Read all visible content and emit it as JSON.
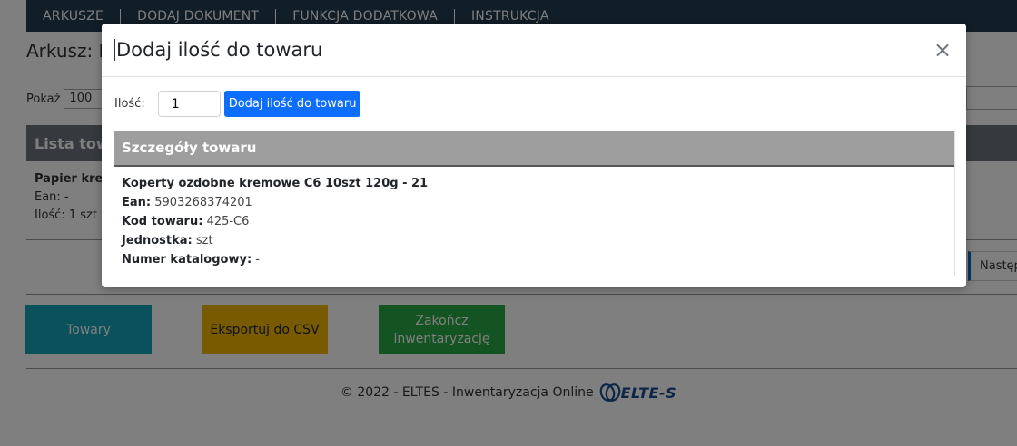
{
  "nav": {
    "items": [
      "ARKUSZE",
      "DODAJ DOKUMENT",
      "FUNKCJA DODATKOWA",
      "INSTRUKCJA"
    ]
  },
  "page": {
    "sheet_title": "Arkusz: I",
    "show_label": "Pokaż",
    "show_value": "100",
    "list_header": "Lista towa",
    "list_item": {
      "name": "Papier kre",
      "ean": "Ean: -",
      "qty": "Ilość: 1 szt"
    },
    "next_label": "Następ"
  },
  "buttons": {
    "towary": "Towary",
    "export": "Eksportuj do CSV",
    "finish": "Zakończ inwentaryzację"
  },
  "footer": {
    "text": "© 2022 - ELTES - Inwentaryzacja Online",
    "logo_text": "ELTE-S"
  },
  "modal": {
    "title": "Dodaj ilość do towaru",
    "close_glyph": "×",
    "qty_label": "Ilość:",
    "qty_value": "1",
    "add_button": "Dodaj ilość do towaru",
    "details_header": "Szczegóły towaru",
    "product": {
      "name": "Koperty ozdobne kremowe C6 10szt 120g - 21",
      "ean_label": "Ean:",
      "ean": "5903268374201",
      "code_label": "Kod towaru:",
      "code": "425-C6",
      "unit_label": "Jednostka:",
      "unit": "szt",
      "catalog_label": "Numer katalogowy:",
      "catalog": "-"
    }
  },
  "colors": {
    "navbar": "#233a4f",
    "primary": "#0d6efd",
    "towary": "#17a2b8",
    "export": "#f0b400",
    "finish": "#28a745",
    "details_header": "#9e9e9e"
  }
}
